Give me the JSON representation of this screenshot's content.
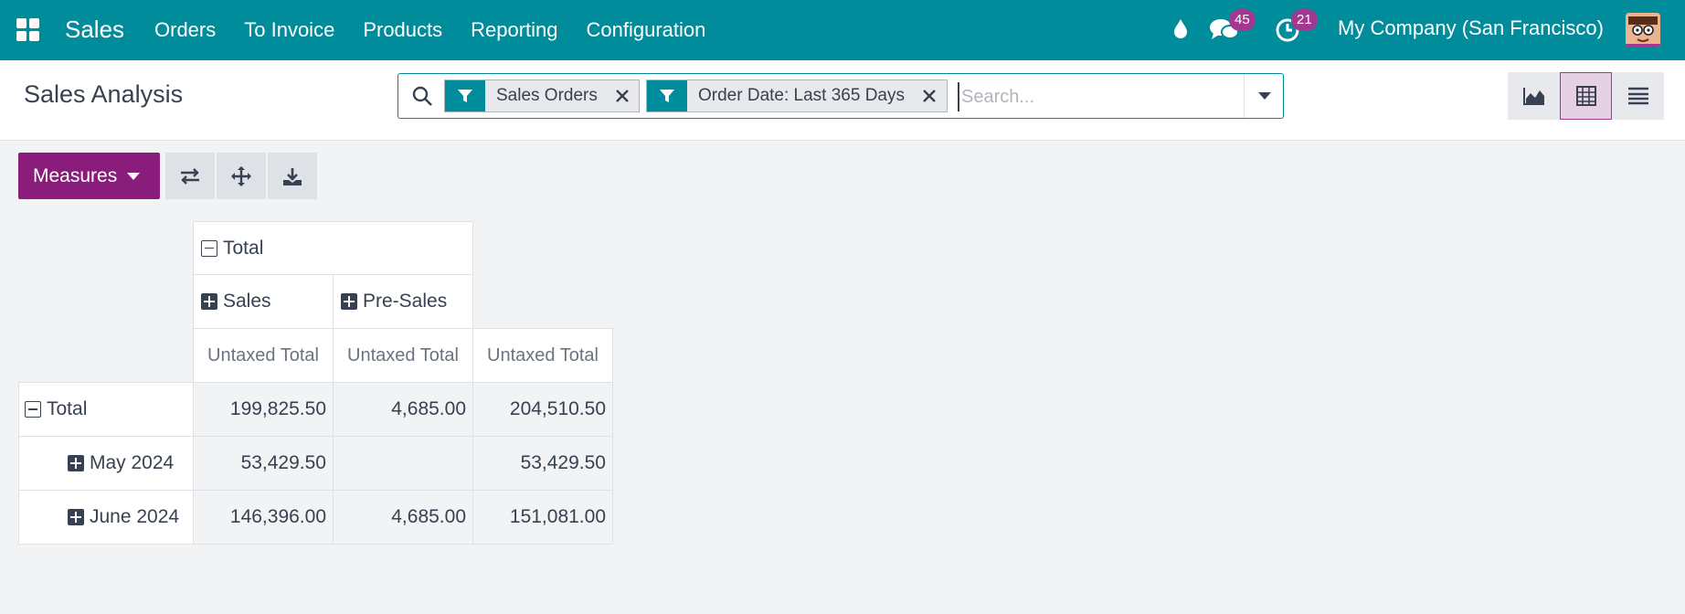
{
  "navbar": {
    "brand": "Sales",
    "menu": [
      "Orders",
      "To Invoice",
      "Products",
      "Reporting",
      "Configuration"
    ],
    "messages_count": "45",
    "activities_count": "21",
    "company": "My Company (San Francisco)",
    "icons": [
      "apps-icon",
      "drop-icon",
      "chat-icon",
      "clock-icon",
      "avatar"
    ]
  },
  "control_panel": {
    "title": "Sales Analysis",
    "facets": [
      {
        "label": "Sales Orders",
        "icon": "filter-icon"
      },
      {
        "label": "Order Date: Last 365 Days",
        "icon": "filter-icon"
      }
    ],
    "search_placeholder": "Search...",
    "views": [
      "graph",
      "pivot",
      "list"
    ],
    "active_view": "pivot"
  },
  "toolbar": {
    "measures_label": "Measures",
    "buttons": [
      "flip-axis-icon",
      "expand-all-icon",
      "download-icon"
    ]
  },
  "pivot": {
    "col_total": "Total",
    "col_groups": [
      "Sales",
      "Pre-Sales"
    ],
    "measure": "Untaxed Total",
    "rows": [
      {
        "label": "Total",
        "values": [
          "199,825.50",
          "4,685.00",
          "204,510.50"
        ],
        "expanded": true
      },
      {
        "label": "May 2024",
        "values": [
          "53,429.50",
          "",
          "53,429.50"
        ],
        "expanded": false
      },
      {
        "label": "June 2024",
        "values": [
          "146,396.00",
          "4,685.00",
          "151,081.00"
        ],
        "expanded": false
      }
    ]
  },
  "colors": {
    "navbar": "#008c9a",
    "primary": "#8a1c7c",
    "badge": "#a33891"
  }
}
